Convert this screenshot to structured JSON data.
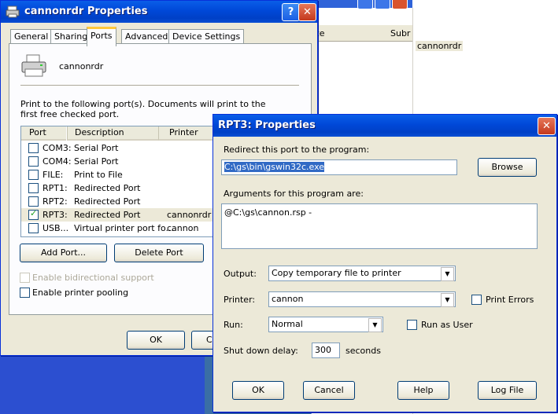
{
  "background_window": {
    "col_size": "ze",
    "col_subr": "Subr",
    "selected_name": "cannonrdr"
  },
  "printer_props": {
    "title": "cannonrdr Properties",
    "tabs": [
      "General",
      "Sharing",
      "Ports",
      "Advanced",
      "Device Settings"
    ],
    "printer_name": "cannonrdr",
    "instructions": "Print to the following port(s). Documents will print to the first free checked port.",
    "columns": [
      "Port",
      "Description",
      "Printer"
    ],
    "ports": [
      {
        "port": "COM3:",
        "description": "Serial Port",
        "printer": "",
        "checked": false
      },
      {
        "port": "COM4:",
        "description": "Serial Port",
        "printer": "",
        "checked": false
      },
      {
        "port": "FILE:",
        "description": "Print to File",
        "printer": "",
        "checked": false
      },
      {
        "port": "RPT1:",
        "description": "Redirected Port",
        "printer": "",
        "checked": false
      },
      {
        "port": "RPT2:",
        "description": "Redirected Port",
        "printer": "",
        "checked": false
      },
      {
        "port": "RPT3:",
        "description": "Redirected Port",
        "printer": "cannonrdr",
        "checked": true
      },
      {
        "port": "USB...",
        "description": "Virtual printer port fo...",
        "printer": "cannon",
        "checked": false
      }
    ],
    "add_port": "Add Port...",
    "delete_port": "Delete Port",
    "bidirectional": "Enable bidirectional support",
    "pooling": "Enable printer pooling",
    "ok": "OK",
    "cancel_partial": "C"
  },
  "rpt_props": {
    "title": "RPT3: Properties",
    "redirect_label": "Redirect this port to the program:",
    "program_path": "C:\\gs\\bin\\gswin32c.exe",
    "browse": "Browse",
    "args_label": "Arguments for this program are:",
    "args_value": "@C:\\gs\\cannon.rsp -",
    "output_label": "Output:",
    "output_value": "Copy temporary file to printer",
    "printer_label": "Printer:",
    "printer_value": "cannon",
    "print_errors": "Print Errors",
    "run_label": "Run:",
    "run_value": "Normal",
    "run_as_user": "Run as User",
    "shutdown_label": "Shut down delay:",
    "shutdown_value": "300",
    "seconds": "seconds",
    "ok": "OK",
    "cancel": "Cancel",
    "help": "Help",
    "logfile": "Log File"
  },
  "colors": {
    "titlebar": "#0054e3",
    "face": "#ece9d8",
    "close": "#e2613f"
  }
}
